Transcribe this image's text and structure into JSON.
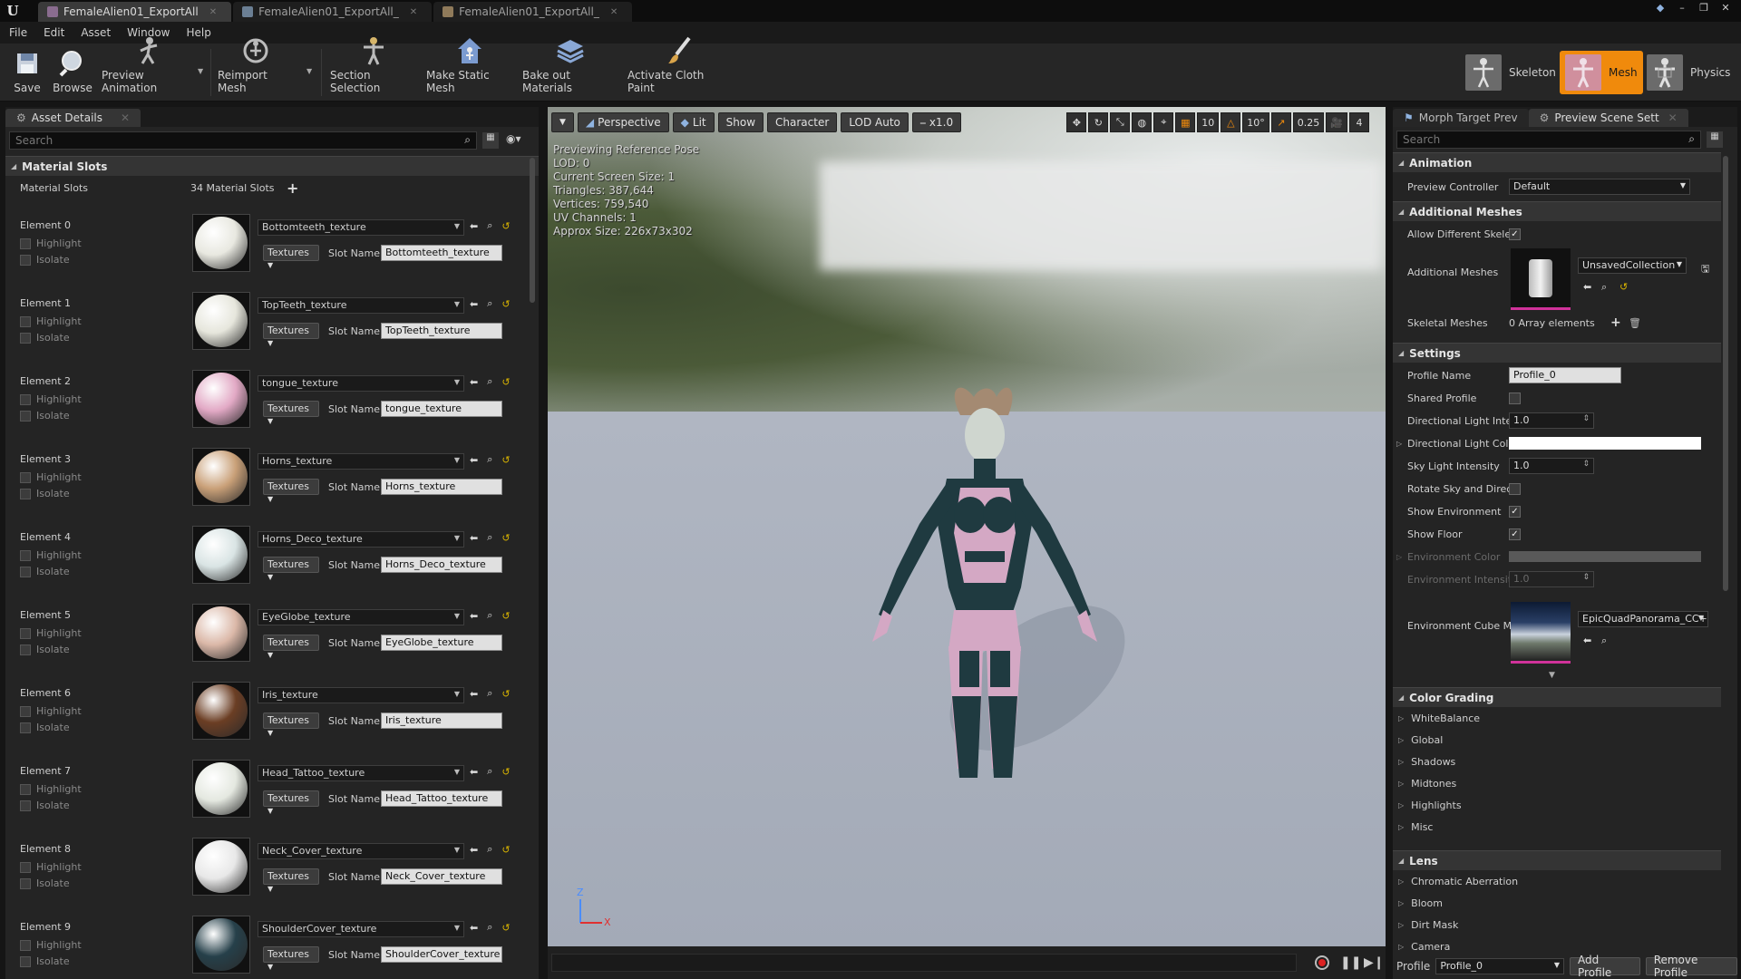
{
  "titlebar": {
    "tabs": [
      {
        "label": "FemaleAlien01_ExportAll"
      },
      {
        "label": "FemaleAlien01_ExportAll_"
      },
      {
        "label": "FemaleAlien01_ExportAll_"
      }
    ]
  },
  "menu": [
    "File",
    "Edit",
    "Asset",
    "Window",
    "Help"
  ],
  "toolbar": {
    "buttons": [
      "Save",
      "Browse",
      "Preview Animation",
      "Reimport Mesh",
      "Section Selection",
      "Make Static Mesh",
      "Bake out Materials",
      "Activate Cloth Paint"
    ],
    "modes": [
      "Skeleton",
      "Mesh",
      "Physics"
    ],
    "active_mode_color": "#f08a0c"
  },
  "left_panel": {
    "tab": "Asset Details",
    "search_placeholder": "Search",
    "section": "Material Slots",
    "slots_label": "Material Slots",
    "slots_count": "34 Material Slots",
    "highlight_label": "Highlight",
    "isolate_label": "Isolate",
    "textures_label": "Textures",
    "slot_name_label": "Slot Name",
    "elements": [
      {
        "name": "Element 0",
        "material": "Bottomteeth_texture",
        "slot": "Bottomteeth_texture",
        "color": "#e8e8e0"
      },
      {
        "name": "Element 1",
        "material": "TopTeeth_texture",
        "slot": "TopTeeth_texture",
        "color": "#e6e6dc"
      },
      {
        "name": "Element 2",
        "material": "tongue_texture",
        "slot": "tongue_texture",
        "color": "#e2a9c5"
      },
      {
        "name": "Element 3",
        "material": "Horns_texture",
        "slot": "Horns_texture",
        "color": "#c9a078"
      },
      {
        "name": "Element 4",
        "material": "Horns_Deco_texture",
        "slot": "Horns_Deco_texture",
        "color": "#d9e4e4"
      },
      {
        "name": "Element 5",
        "material": "EyeGlobe_texture",
        "slot": "EyeGlobe_texture",
        "color": "#dbb8a8"
      },
      {
        "name": "Element 6",
        "material": "Iris_texture",
        "slot": "Iris_texture",
        "color": "#6b3e24"
      },
      {
        "name": "Element 7",
        "material": "Head_Tattoo_texture",
        "slot": "Head_Tattoo_texture",
        "color": "#e4e8e0"
      },
      {
        "name": "Element 8",
        "material": "Neck_Cover_texture",
        "slot": "Neck_Cover_texture",
        "color": "#e8e8e8"
      },
      {
        "name": "Element 9",
        "material": "ShoulderCover_texture",
        "slot": "ShoulderCover_texture",
        "color": "#26404a"
      }
    ]
  },
  "viewport": {
    "buttons": [
      "Perspective",
      "Lit",
      "Show",
      "Character",
      "LOD Auto",
      "x1.0"
    ],
    "right_values": [
      "10",
      "10°",
      "0.25",
      "4"
    ],
    "stats": [
      "Previewing Reference Pose",
      "LOD: 0",
      "Current Screen Size: 1",
      "Triangles: 387,644",
      "Vertices: 759,540",
      "UV Channels: 1",
      "Approx Size: 226x73x302"
    ],
    "axis_z": "Z",
    "axis_x": "X"
  },
  "right_panel": {
    "tabs": [
      "Morph Target Prev",
      "Preview Scene Sett"
    ],
    "search_placeholder": "Search",
    "animation": {
      "title": "Animation",
      "preview_controller_label": "Preview Controller",
      "preview_controller_value": "Default"
    },
    "additional_meshes": {
      "title": "Additional Meshes",
      "allow_label": "Allow Different Skelet",
      "meshes_label": "Additional Meshes",
      "collection": "UnsavedCollection",
      "skeletal_label": "Skeletal Meshes",
      "skeletal_value": "0 Array elements"
    },
    "settings": {
      "title": "Settings",
      "profile_name_label": "Profile Name",
      "profile_name_value": "Profile_0",
      "shared_profile_label": "Shared Profile",
      "dir_light_int_label": "Directional Light Inten",
      "dir_light_int_value": "1.0",
      "dir_light_color_label": "Directional Light Colo",
      "sky_light_label": "Sky Light Intensity",
      "sky_light_value": "1.0",
      "rotate_sky_label": "Rotate Sky and Direct",
      "show_env_label": "Show Environment",
      "show_floor_label": "Show Floor",
      "env_color_label": "Environment Color",
      "env_intensity_label": "Environment Intensity",
      "env_intensity_value": "1.0",
      "env_cube_label": "Environment Cube Ma",
      "env_cube_value": "EpicQuadPanorama_CC+E"
    },
    "color_grading": {
      "title": "Color Grading",
      "items": [
        "WhiteBalance",
        "Global",
        "Shadows",
        "Midtones",
        "Highlights",
        "Misc"
      ]
    },
    "lens": {
      "title": "Lens",
      "items": [
        "Chromatic Aberration",
        "Bloom",
        "Dirt Mask",
        "Camera"
      ]
    },
    "bottom": {
      "profile_label": "Profile",
      "profile_value": "Profile_0",
      "add_profile": "Add Profile",
      "remove_profile": "Remove Profile"
    }
  }
}
